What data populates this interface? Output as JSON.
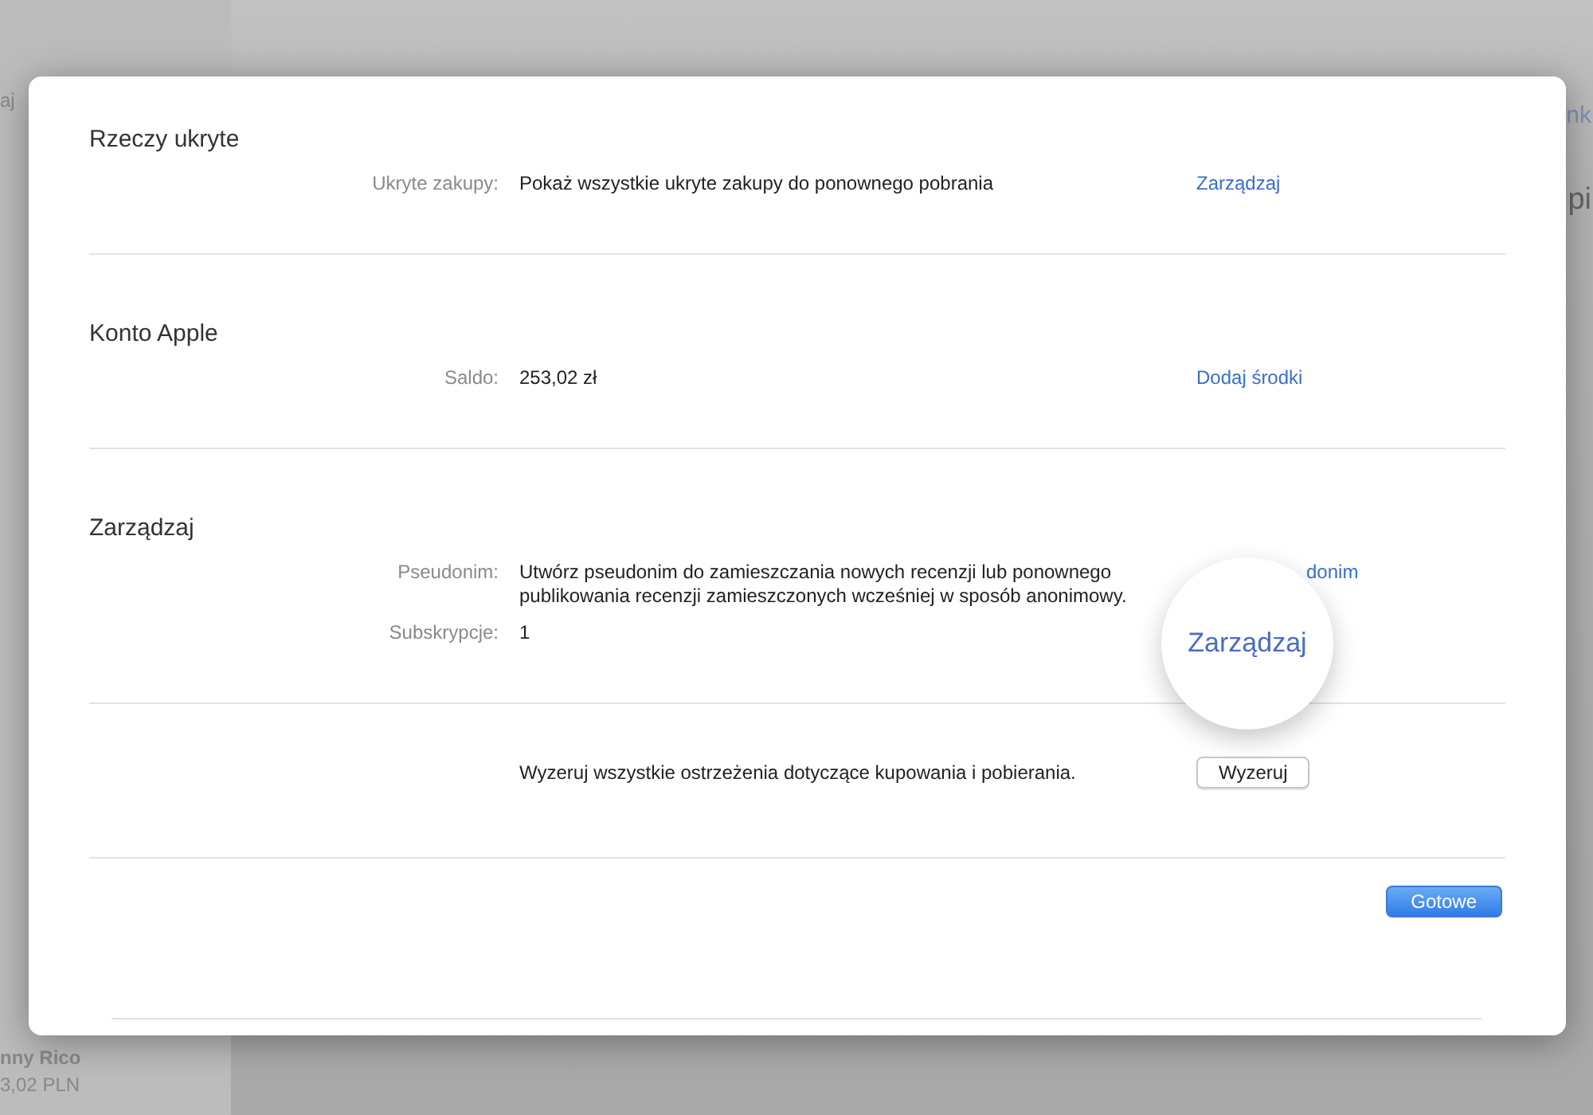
{
  "background": {
    "sidebar_item": "aj",
    "account_name": "nny Rico",
    "account_balance": "3,02 PLN",
    "header_link": "nk",
    "heading": "pi"
  },
  "sections": [
    {
      "title": "Rzeczy ukryte",
      "rows": [
        {
          "label": "Ukryte zakupy:",
          "value": "Pokaż wszystkie ukryte zakupy do ponownego pobrania",
          "action": {
            "kind": "link",
            "text": "Zarządzaj"
          }
        }
      ]
    },
    {
      "title": "Konto Apple",
      "rows": [
        {
          "label": "Saldo:",
          "value": "253,02 zł",
          "action": {
            "kind": "link",
            "text": "Dodaj środki"
          }
        }
      ]
    },
    {
      "title": "Zarządzaj",
      "rows": [
        {
          "label": "Pseudonim:",
          "value": "Utwórz pseudonim do zamieszczania nowych recenzji lub ponownego publikowania recenzji zamieszczonych wcześniej w sposób anonimowy.",
          "action": {
            "kind": "cut-link",
            "text": "donim"
          }
        },
        {
          "label": "Subskrypcje:",
          "value": "1"
        }
      ]
    },
    {
      "rows": [
        {
          "value": "Wyzeruj wszystkie ostrzeżenia dotyczące kupowania i pobierania.",
          "action": {
            "kind": "button",
            "text": "Wyzeruj"
          }
        }
      ]
    }
  ],
  "magnifier": {
    "text": "Zarządzaj"
  },
  "done_button": "Gotowe"
}
